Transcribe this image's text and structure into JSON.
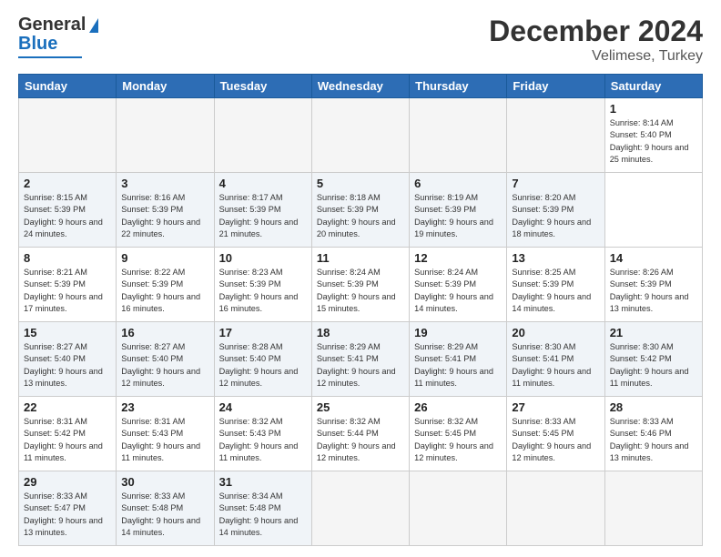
{
  "header": {
    "logo_line1": "General",
    "logo_line2": "Blue",
    "title": "December 2024",
    "subtitle": "Velimese, Turkey"
  },
  "calendar": {
    "days_of_week": [
      "Sunday",
      "Monday",
      "Tuesday",
      "Wednesday",
      "Thursday",
      "Friday",
      "Saturday"
    ],
    "weeks": [
      [
        null,
        null,
        null,
        null,
        null,
        null,
        {
          "day": "1",
          "sunrise": "Sunrise: 8:14 AM",
          "sunset": "Sunset: 5:40 PM",
          "daylight": "Daylight: 9 hours and 25 minutes."
        }
      ],
      [
        {
          "day": "2",
          "sunrise": "Sunrise: 8:15 AM",
          "sunset": "Sunset: 5:39 PM",
          "daylight": "Daylight: 9 hours and 24 minutes."
        },
        {
          "day": "3",
          "sunrise": "Sunrise: 8:16 AM",
          "sunset": "Sunset: 5:39 PM",
          "daylight": "Daylight: 9 hours and 22 minutes."
        },
        {
          "day": "4",
          "sunrise": "Sunrise: 8:17 AM",
          "sunset": "Sunset: 5:39 PM",
          "daylight": "Daylight: 9 hours and 21 minutes."
        },
        {
          "day": "5",
          "sunrise": "Sunrise: 8:18 AM",
          "sunset": "Sunset: 5:39 PM",
          "daylight": "Daylight: 9 hours and 20 minutes."
        },
        {
          "day": "6",
          "sunrise": "Sunrise: 8:19 AM",
          "sunset": "Sunset: 5:39 PM",
          "daylight": "Daylight: 9 hours and 19 minutes."
        },
        {
          "day": "7",
          "sunrise": "Sunrise: 8:20 AM",
          "sunset": "Sunset: 5:39 PM",
          "daylight": "Daylight: 9 hours and 18 minutes."
        }
      ],
      [
        {
          "day": "8",
          "sunrise": "Sunrise: 8:21 AM",
          "sunset": "Sunset: 5:39 PM",
          "daylight": "Daylight: 9 hours and 17 minutes."
        },
        {
          "day": "9",
          "sunrise": "Sunrise: 8:22 AM",
          "sunset": "Sunset: 5:39 PM",
          "daylight": "Daylight: 9 hours and 16 minutes."
        },
        {
          "day": "10",
          "sunrise": "Sunrise: 8:23 AM",
          "sunset": "Sunset: 5:39 PM",
          "daylight": "Daylight: 9 hours and 16 minutes."
        },
        {
          "day": "11",
          "sunrise": "Sunrise: 8:24 AM",
          "sunset": "Sunset: 5:39 PM",
          "daylight": "Daylight: 9 hours and 15 minutes."
        },
        {
          "day": "12",
          "sunrise": "Sunrise: 8:24 AM",
          "sunset": "Sunset: 5:39 PM",
          "daylight": "Daylight: 9 hours and 14 minutes."
        },
        {
          "day": "13",
          "sunrise": "Sunrise: 8:25 AM",
          "sunset": "Sunset: 5:39 PM",
          "daylight": "Daylight: 9 hours and 14 minutes."
        },
        {
          "day": "14",
          "sunrise": "Sunrise: 8:26 AM",
          "sunset": "Sunset: 5:39 PM",
          "daylight": "Daylight: 9 hours and 13 minutes."
        }
      ],
      [
        {
          "day": "15",
          "sunrise": "Sunrise: 8:27 AM",
          "sunset": "Sunset: 5:40 PM",
          "daylight": "Daylight: 9 hours and 13 minutes."
        },
        {
          "day": "16",
          "sunrise": "Sunrise: 8:27 AM",
          "sunset": "Sunset: 5:40 PM",
          "daylight": "Daylight: 9 hours and 12 minutes."
        },
        {
          "day": "17",
          "sunrise": "Sunrise: 8:28 AM",
          "sunset": "Sunset: 5:40 PM",
          "daylight": "Daylight: 9 hours and 12 minutes."
        },
        {
          "day": "18",
          "sunrise": "Sunrise: 8:29 AM",
          "sunset": "Sunset: 5:41 PM",
          "daylight": "Daylight: 9 hours and 12 minutes."
        },
        {
          "day": "19",
          "sunrise": "Sunrise: 8:29 AM",
          "sunset": "Sunset: 5:41 PM",
          "daylight": "Daylight: 9 hours and 11 minutes."
        },
        {
          "day": "20",
          "sunrise": "Sunrise: 8:30 AM",
          "sunset": "Sunset: 5:41 PM",
          "daylight": "Daylight: 9 hours and 11 minutes."
        },
        {
          "day": "21",
          "sunrise": "Sunrise: 8:30 AM",
          "sunset": "Sunset: 5:42 PM",
          "daylight": "Daylight: 9 hours and 11 minutes."
        }
      ],
      [
        {
          "day": "22",
          "sunrise": "Sunrise: 8:31 AM",
          "sunset": "Sunset: 5:42 PM",
          "daylight": "Daylight: 9 hours and 11 minutes."
        },
        {
          "day": "23",
          "sunrise": "Sunrise: 8:31 AM",
          "sunset": "Sunset: 5:43 PM",
          "daylight": "Daylight: 9 hours and 11 minutes."
        },
        {
          "day": "24",
          "sunrise": "Sunrise: 8:32 AM",
          "sunset": "Sunset: 5:43 PM",
          "daylight": "Daylight: 9 hours and 11 minutes."
        },
        {
          "day": "25",
          "sunrise": "Sunrise: 8:32 AM",
          "sunset": "Sunset: 5:44 PM",
          "daylight": "Daylight: 9 hours and 12 minutes."
        },
        {
          "day": "26",
          "sunrise": "Sunrise: 8:32 AM",
          "sunset": "Sunset: 5:45 PM",
          "daylight": "Daylight: 9 hours and 12 minutes."
        },
        {
          "day": "27",
          "sunrise": "Sunrise: 8:33 AM",
          "sunset": "Sunset: 5:45 PM",
          "daylight": "Daylight: 9 hours and 12 minutes."
        },
        {
          "day": "28",
          "sunrise": "Sunrise: 8:33 AM",
          "sunset": "Sunset: 5:46 PM",
          "daylight": "Daylight: 9 hours and 13 minutes."
        }
      ],
      [
        {
          "day": "29",
          "sunrise": "Sunrise: 8:33 AM",
          "sunset": "Sunset: 5:47 PM",
          "daylight": "Daylight: 9 hours and 13 minutes."
        },
        {
          "day": "30",
          "sunrise": "Sunrise: 8:33 AM",
          "sunset": "Sunset: 5:48 PM",
          "daylight": "Daylight: 9 hours and 14 minutes."
        },
        {
          "day": "31",
          "sunrise": "Sunrise: 8:34 AM",
          "sunset": "Sunset: 5:48 PM",
          "daylight": "Daylight: 9 hours and 14 minutes."
        },
        null,
        null,
        null,
        null
      ]
    ]
  }
}
